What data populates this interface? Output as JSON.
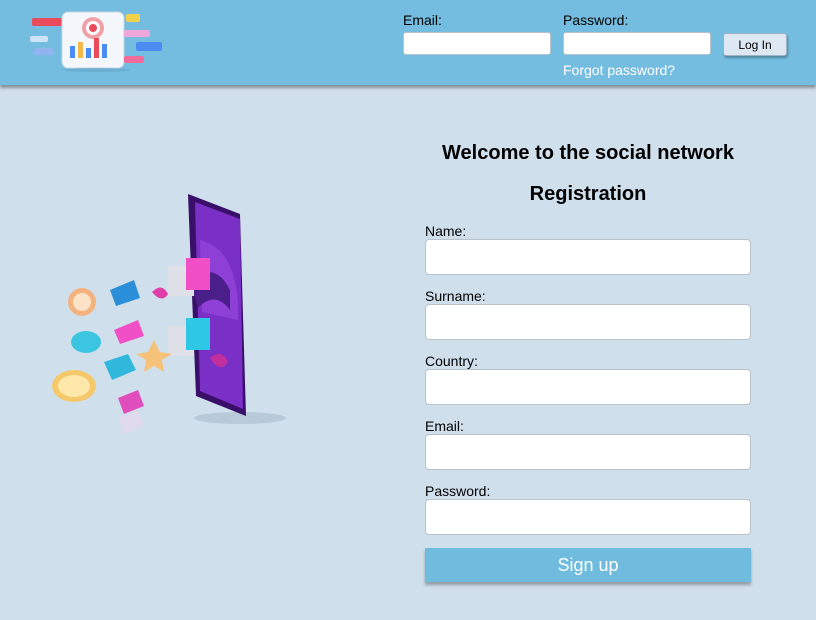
{
  "header": {
    "email_label": "Email:",
    "password_label": "Password:",
    "login_label": "Log In",
    "forgot_label": "Forgot password?"
  },
  "main": {
    "title": "Welcome to the social network",
    "subtitle": "Registration",
    "fields": {
      "name": "Name:",
      "surname": "Surname:",
      "country": "Country:",
      "email": "Email:",
      "password": "Password:"
    },
    "signup_label": "Sign up"
  },
  "colors": {
    "header_bg": "#74bde0",
    "page_bg": "#d0dfec",
    "button_bg": "#6fbcde"
  },
  "icons": [
    "analytics-logo-icon",
    "phone-magnet-illustration"
  ]
}
